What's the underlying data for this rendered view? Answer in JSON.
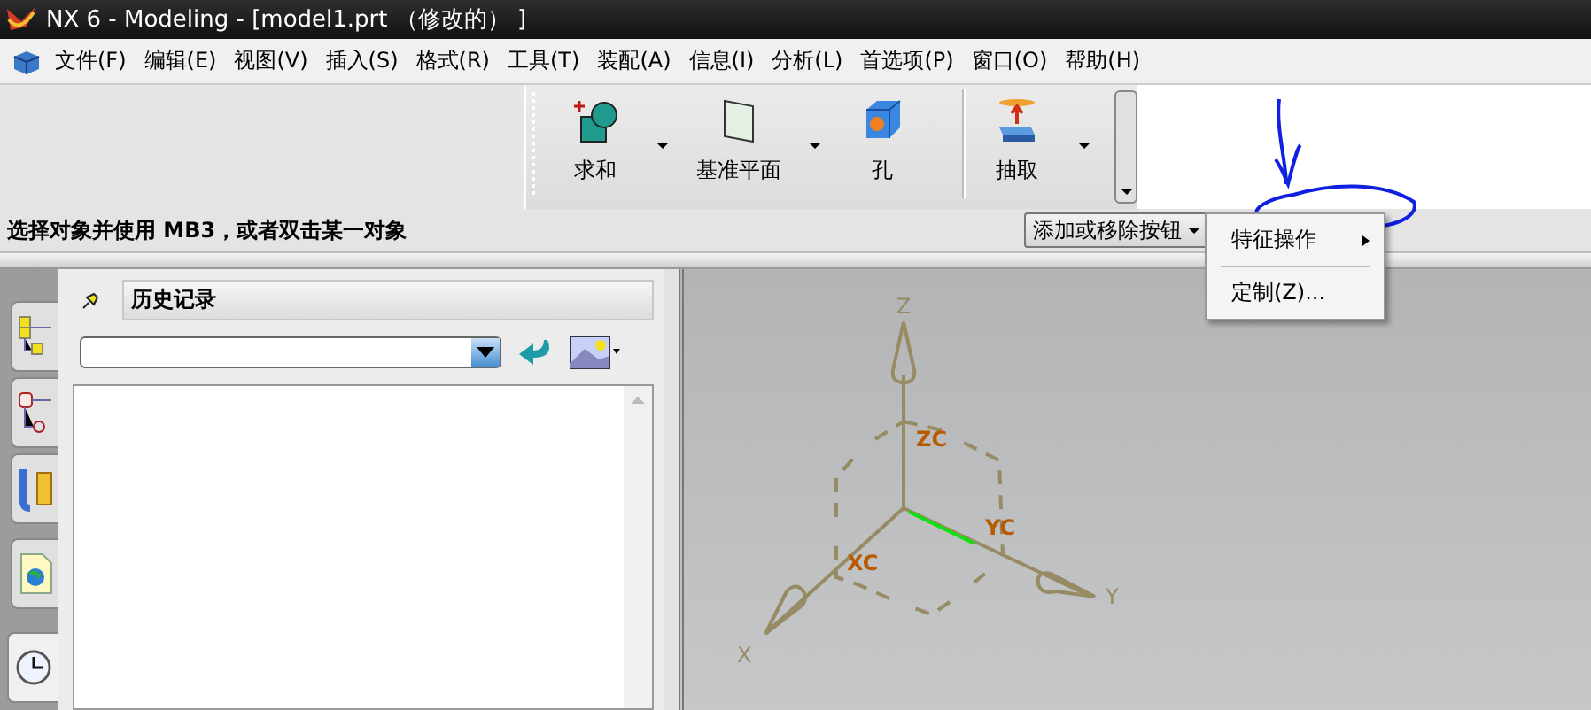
{
  "window": {
    "title": "NX 6 - Modeling - [model1.prt （修改的） ]"
  },
  "menu": [
    "文件(F)",
    "编辑(E)",
    "视图(V)",
    "插入(S)",
    "格式(R)",
    "工具(T)",
    "装配(A)",
    "信息(I)",
    "分析(L)",
    "首选项(P)",
    "窗口(O)",
    "帮助(H)"
  ],
  "toolbar": {
    "items": [
      {
        "kind": "unite",
        "label": "求和",
        "dropdown": true
      },
      {
        "kind": "datum-plane",
        "label": "基准平面",
        "dropdown": true
      },
      {
        "kind": "hole",
        "label": "孔",
        "dropdown": false
      },
      {
        "kind": "extract",
        "label": "抽取",
        "dropdown": true
      }
    ]
  },
  "prompt": "选择对象并使用 MB3，或者双击某一对象",
  "add_remove_button": "添加或移除按钮",
  "popup_menu": [
    {
      "label": "特征操作",
      "submenu": true
    },
    {
      "label": "定制(Z)...",
      "submenu": false
    }
  ],
  "resource_tabs": [
    {
      "kind": "assembly",
      "selected": false
    },
    {
      "kind": "part",
      "selected": false
    },
    {
      "kind": "constraint",
      "selected": false
    },
    {
      "kind": "web",
      "selected": false
    },
    {
      "kind": "history",
      "selected": true
    }
  ],
  "navigator": {
    "title": "历史记录"
  },
  "viewport": {
    "labels": [
      "Z",
      "ZC",
      "XC",
      "YC",
      "Y",
      "X"
    ]
  }
}
